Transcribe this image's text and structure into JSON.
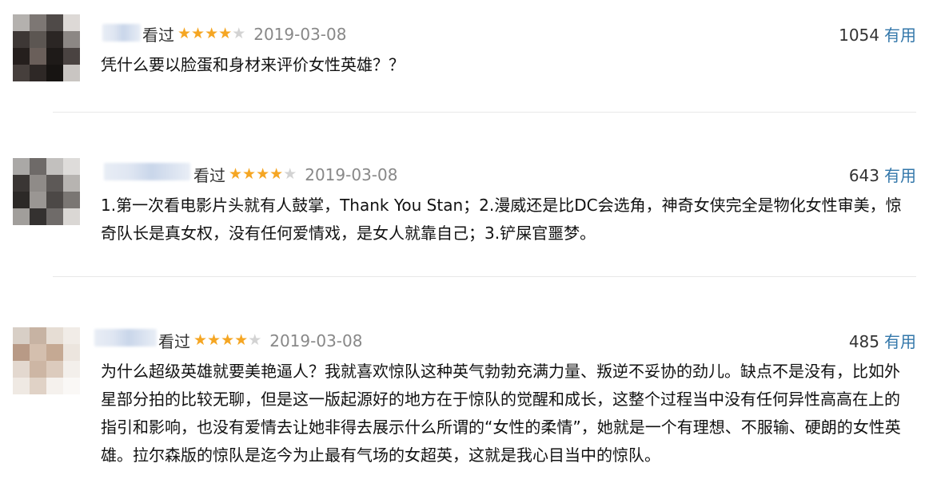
{
  "comments": [
    {
      "status": "看过",
      "rating": 4,
      "date": "2019-03-08",
      "votes": "1054",
      "useful_label": "有用",
      "text": "凭什么要以脸蛋和身材来评价女性英雄？？"
    },
    {
      "status": "看过",
      "rating": 4,
      "date": "2019-03-08",
      "votes": "643",
      "useful_label": "有用",
      "text": "1.第一次看电影片头就有人鼓掌，Thank You Stan；2.漫威还是比DC会选角，神奇女侠完全是物化女性审美，惊奇队长是真女权，没有任何爱情戏，是女人就靠自己；3.铲屎官噩梦。"
    },
    {
      "status": "看过",
      "rating": 4,
      "date": "2019-03-08",
      "votes": "485",
      "useful_label": "有用",
      "text": "为什么超级英雄就要美艳逼人？我就喜欢惊队这种英气勃勃充满力量、叛逆不妥协的劲儿。缺点不是没有，比如外星部分拍的比较无聊，但是这一版起源好的地方在于惊队的觉醒和成长，这整个过程当中没有任何异性高高在上的指引和影响，也没有爱情去让她非得去展示什么所谓的“女性的柔情”，她就是一个有理想、不服输、硬朗的女性英雄。拉尔森版的惊队是迄今为止最有气场的女超英，这就是我心目当中的惊队。"
    }
  ],
  "colors": {
    "star_on": "#f5a623",
    "star_off": "#d3d3d3",
    "useful_link": "#3377aa",
    "date": "#888888"
  },
  "icons": {
    "rating": "star-icon"
  }
}
